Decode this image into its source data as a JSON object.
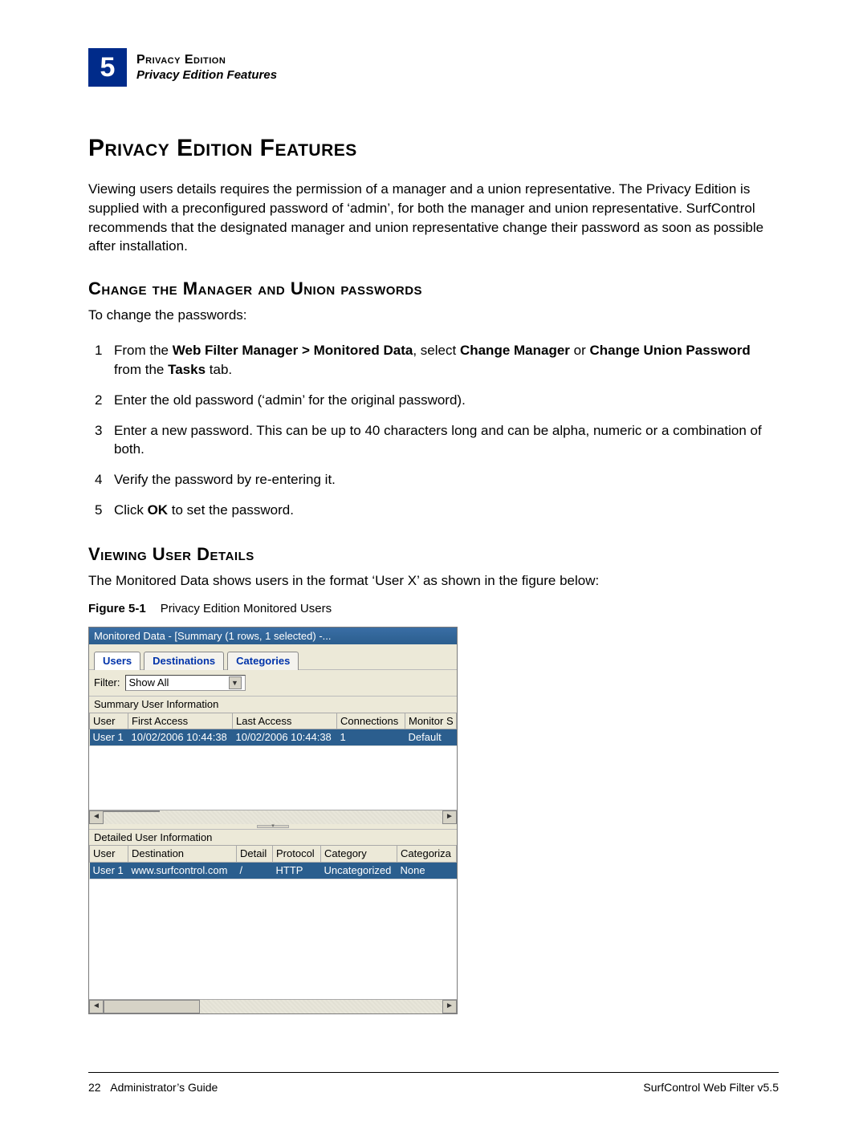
{
  "header": {
    "chapter_number": "5",
    "title": "Privacy Edition",
    "subtitle": "Privacy Edition Features"
  },
  "page_title": "Privacy Edition Features",
  "intro": "Viewing users details requires the permission of a manager and a union representative. The Privacy Edition is supplied with a preconfigured password of ‘admin’, for both the manager and union representative. SurfControl recommends that the designated manager and union representative change their password as soon as possible after installation.",
  "section1": {
    "heading": "Change the Manager and Union passwords",
    "lead": "To change the passwords:",
    "steps": {
      "s1_num": "1",
      "s1_a": "From the ",
      "s1_b": "Web Filter Manager > Monitored Data",
      "s1_c": ", select ",
      "s1_d": "Change Manager",
      "s1_e": " or ",
      "s1_f": "Change Union Password",
      "s1_g": " from the ",
      "s1_h": "Tasks",
      "s1_i": " tab.",
      "s2_num": "2",
      "s2": "Enter the old password (‘admin’ for the original password).",
      "s3_num": "3",
      "s3": "Enter a new password. This can be up to 40 characters long and can be alpha, numeric or a combination of both.",
      "s4_num": "4",
      "s4": "Verify the password by re-entering it.",
      "s5_num": "5",
      "s5_a": "Click ",
      "s5_b": "OK",
      "s5_c": " to set the password."
    }
  },
  "section2": {
    "heading": "Viewing User Details",
    "lead": "The Monitored Data shows users in the format ‘User X’ as shown in the figure below:"
  },
  "figure": {
    "label": "Figure 5-1",
    "caption": "Privacy Edition Monitored Users"
  },
  "window": {
    "title": "Monitored Data - [Summary (1 rows, 1 selected) -...",
    "tabs": {
      "users": "Users",
      "destinations": "Destinations",
      "categories": "Categories"
    },
    "filter": {
      "label": "Filter:",
      "value": "Show All"
    },
    "summary": {
      "panel_label": "Summary User Information",
      "cols": {
        "c1": "User",
        "c2": "First Access",
        "c3": "Last Access",
        "c4": "Connections",
        "c5": "Monitor S"
      },
      "row1": {
        "c1": "User 1",
        "c2": "10/02/2006 10:44:38",
        "c3": "10/02/2006 10:44:38",
        "c4": "1",
        "c5": "Default"
      }
    },
    "detail": {
      "panel_label": "Detailed User Information",
      "cols": {
        "c1": "User",
        "c2": "Destination",
        "c3": "Detail",
        "c4": "Protocol",
        "c5": "Category",
        "c6": "Categoriza"
      },
      "row1": {
        "c1": "User 1",
        "c2": "www.surfcontrol.com",
        "c3": "/",
        "c4": "HTTP",
        "c5": "Uncategorized",
        "c6": "None"
      }
    }
  },
  "footer": {
    "page": "22",
    "left": "Administrator’s Guide",
    "right": "SurfControl Web Filter v5.5"
  }
}
